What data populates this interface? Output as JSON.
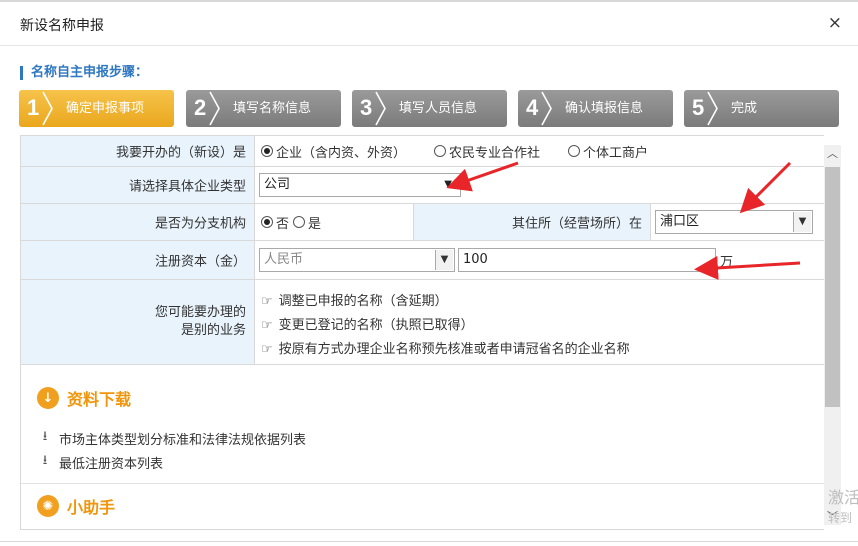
{
  "dialog": {
    "title": "新设名称申报",
    "close_symbol": "×"
  },
  "steps_heading": "名称自主申报步骤：",
  "steps": [
    {
      "num": "1",
      "label": "确定申报事项"
    },
    {
      "num": "2",
      "label": "填写名称信息"
    },
    {
      "num": "3",
      "label": "填写人员信息"
    },
    {
      "num": "4",
      "label": "确认填报信息"
    },
    {
      "num": "5",
      "label": "完成"
    }
  ],
  "colors": {
    "active_step": "#eaa71e",
    "inactive_step": "#8a8a8a",
    "label_bg": "#e8f3fb",
    "accent": "#2e77c2",
    "section": "#f0960c",
    "arrows": "#e8262a"
  },
  "form": {
    "open_type": {
      "label": "我要开办的（新设）是",
      "options": [
        "企业（含内资、外资）",
        "农民专业合作社",
        "个体工商户"
      ]
    },
    "company_type": {
      "label": "请选择具体企业类型",
      "value": "公司"
    },
    "branch": {
      "label": "是否为分支机构",
      "options": [
        "否",
        "是"
      ],
      "residence_label": "其住所（经营场所）在",
      "residence_value": "浦口区"
    },
    "capital": {
      "label": "注册资本（金）",
      "currency": "人民币",
      "amount": "100",
      "unit": "万"
    },
    "other_business": {
      "label_line1": "您可能要办理的",
      "label_line2": "是别的业务",
      "options": [
        "调整已申报的名称（含延期）",
        "变更已登记的名称（执照已取得）",
        "按原有方式办理企业名称预先核准或者申请冠省名的企业名称"
      ]
    }
  },
  "downloads": {
    "heading": "资料下载",
    "items": [
      "市场主体类型划分标准和法律法规依据列表",
      "最低注册资本列表"
    ]
  },
  "helper": {
    "heading": "小助手"
  },
  "watermark": {
    "line1": "激活",
    "line2": "转到"
  }
}
